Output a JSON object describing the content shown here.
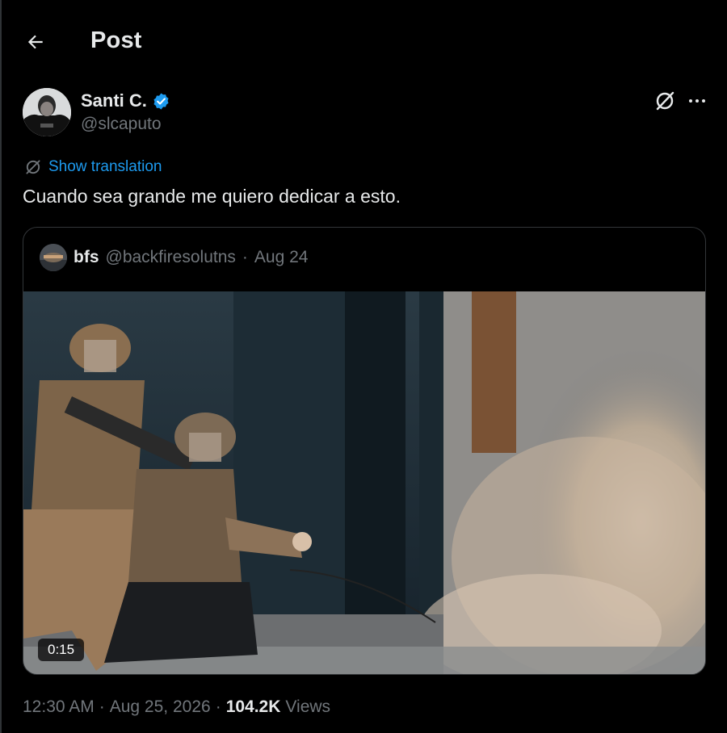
{
  "header": {
    "title": "Post",
    "back_icon": "arrow-left-icon"
  },
  "author": {
    "name": "Santi C.",
    "handle": "@slcaputo",
    "verified": true,
    "verified_color": "#1d9bf0"
  },
  "actions": {
    "grok_icon": "grok-icon",
    "more_icon": "more-horizontal-icon"
  },
  "translation": {
    "label": "Show translation",
    "icon": "grok-icon"
  },
  "post": {
    "text": "Cuando sea grande me quiero dedicar a esto."
  },
  "quote": {
    "name": "bfs",
    "handle": "@backfiresolutns",
    "separator": "·",
    "date": "Aug 24",
    "video_duration": "0:15"
  },
  "meta": {
    "time": "12:30 AM",
    "separator": "·",
    "date": "Aug 25, 2026",
    "separator2": "·",
    "views_count": "104.2K",
    "views_label": "Views"
  },
  "colors": {
    "background": "#000000",
    "text": "#e7e9ea",
    "secondary": "#71767b",
    "accent": "#1d9bf0",
    "border": "#333639"
  }
}
